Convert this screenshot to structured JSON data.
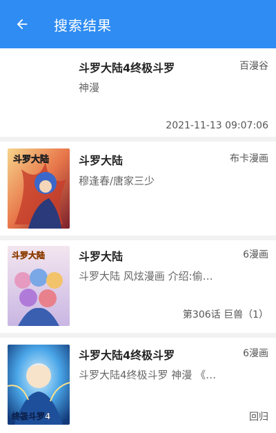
{
  "appbar": {
    "back_icon": "arrow-left-icon",
    "title": "搜索结果",
    "color": "#2f8cf2"
  },
  "results": [
    {
      "title": "斗罗大陆4终极斗罗",
      "source": "百漫谷",
      "desc": "神漫",
      "latest": "2021-11-13 09:07:06",
      "has_cover": false
    },
    {
      "title": "斗罗大陆",
      "source": "布卡漫画",
      "desc": "穆逢春/唐家三少",
      "latest": "",
      "has_cover": true,
      "cover_text": "斗罗大陆"
    },
    {
      "title": "斗罗大陆",
      "source": "6漫画",
      "desc": "斗罗大陆 风炫漫画 介绍:偷…",
      "latest": "第306话 巨兽（1）",
      "has_cover": true,
      "cover_text": "斗罗大陆"
    },
    {
      "title": "斗罗大陆4终极斗罗",
      "source": "6漫画",
      "desc": "斗罗大陆4终极斗罗 神漫 《…",
      "latest": "回归",
      "has_cover": true,
      "cover_text": "终极斗罗4"
    }
  ]
}
